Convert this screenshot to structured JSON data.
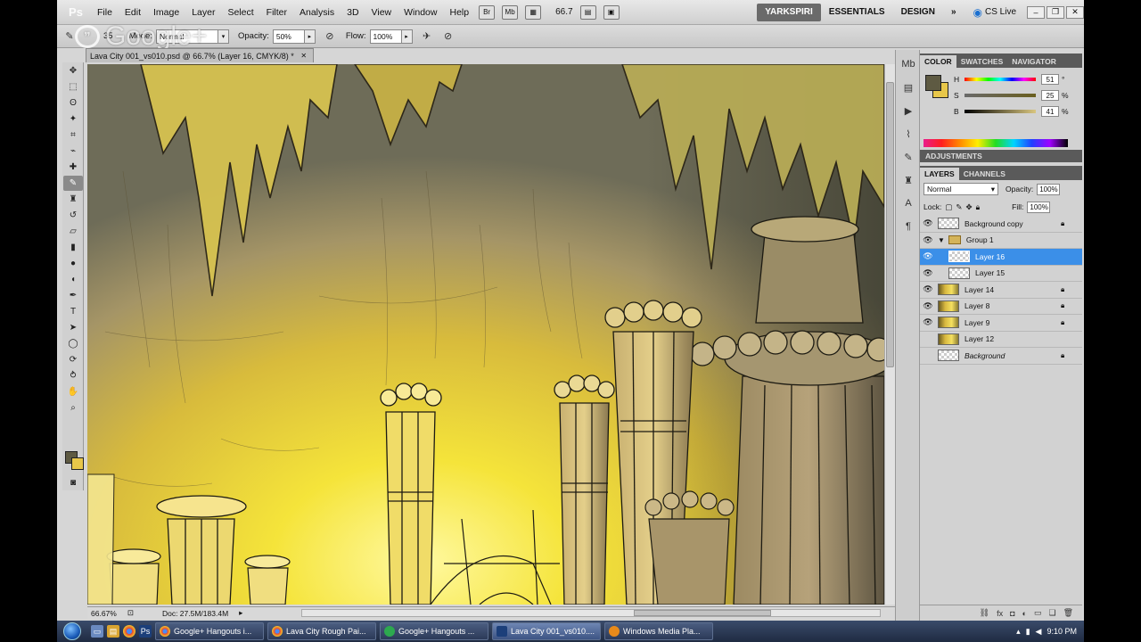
{
  "app": {
    "logo": "Ps"
  },
  "menubar": {
    "items": [
      "File",
      "Edit",
      "Image",
      "Layer",
      "Select",
      "Filter",
      "Analysis",
      "3D",
      "View",
      "Window",
      "Help"
    ],
    "zoom": "66.7",
    "workspaces": [
      "YARKSPIRI",
      "ESSENTIALS",
      "DESIGN"
    ],
    "more": "»",
    "cslive": "CS Live"
  },
  "options": {
    "brush_size": "35",
    "mode_label": "Mode:",
    "mode_value": "Normal",
    "opacity_label": "Opacity:",
    "opacity_value": "50%",
    "flow_label": "Flow:",
    "flow_value": "100%"
  },
  "overlay": {
    "brand": "Google+"
  },
  "document": {
    "tab_title": "Lava City 001_vs010.psd @ 66.7% (Layer 16, CMYK/8) *",
    "zoom_status": "66.67%",
    "doc_size": "Doc: 27.5M/183.4M"
  },
  "color_panel": {
    "tabs": [
      "COLOR",
      "SWATCHES",
      "NAVIGATOR"
    ],
    "sliders": [
      {
        "label": "H",
        "value": "51",
        "unit": "°"
      },
      {
        "label": "S",
        "value": "25",
        "unit": "%"
      },
      {
        "label": "B",
        "value": "41",
        "unit": "%"
      }
    ],
    "fg_color": "#5e5a42",
    "bg_color": "#e8c74a"
  },
  "adjustments": {
    "title": "ADJUSTMENTS"
  },
  "layers_panel": {
    "tabs": [
      "LAYERS",
      "CHANNELS"
    ],
    "blend_mode": "Normal",
    "opacity_label": "Opacity:",
    "opacity_value": "100%",
    "lock_label": "Lock:",
    "fill_label": "Fill:",
    "fill_value": "100%",
    "layers": [
      {
        "name": "Background copy",
        "visible": true,
        "locked": true
      },
      {
        "name": "Group 1",
        "visible": true,
        "locked": false
      },
      {
        "name": "Layer 16",
        "visible": true,
        "locked": false,
        "selected": true
      },
      {
        "name": "Layer 15",
        "visible": true,
        "locked": false
      },
      {
        "name": "Layer 14",
        "visible": true,
        "locked": true
      },
      {
        "name": "Layer 8",
        "visible": true,
        "locked": true
      },
      {
        "name": "Layer 9",
        "visible": true,
        "locked": true
      },
      {
        "name": "Layer 12",
        "visible": false,
        "locked": false
      },
      {
        "name": "Background",
        "visible": false,
        "locked": true
      }
    ]
  },
  "taskbar": {
    "tasks": [
      {
        "label": "Google+ Hangouts i..."
      },
      {
        "label": "Lava City Rough Pai..."
      },
      {
        "label": "Google+ Hangouts ..."
      },
      {
        "label": "Lava City 001_vs010...."
      },
      {
        "label": "Windows Media Pla..."
      }
    ],
    "clock": "9:10 PM"
  }
}
